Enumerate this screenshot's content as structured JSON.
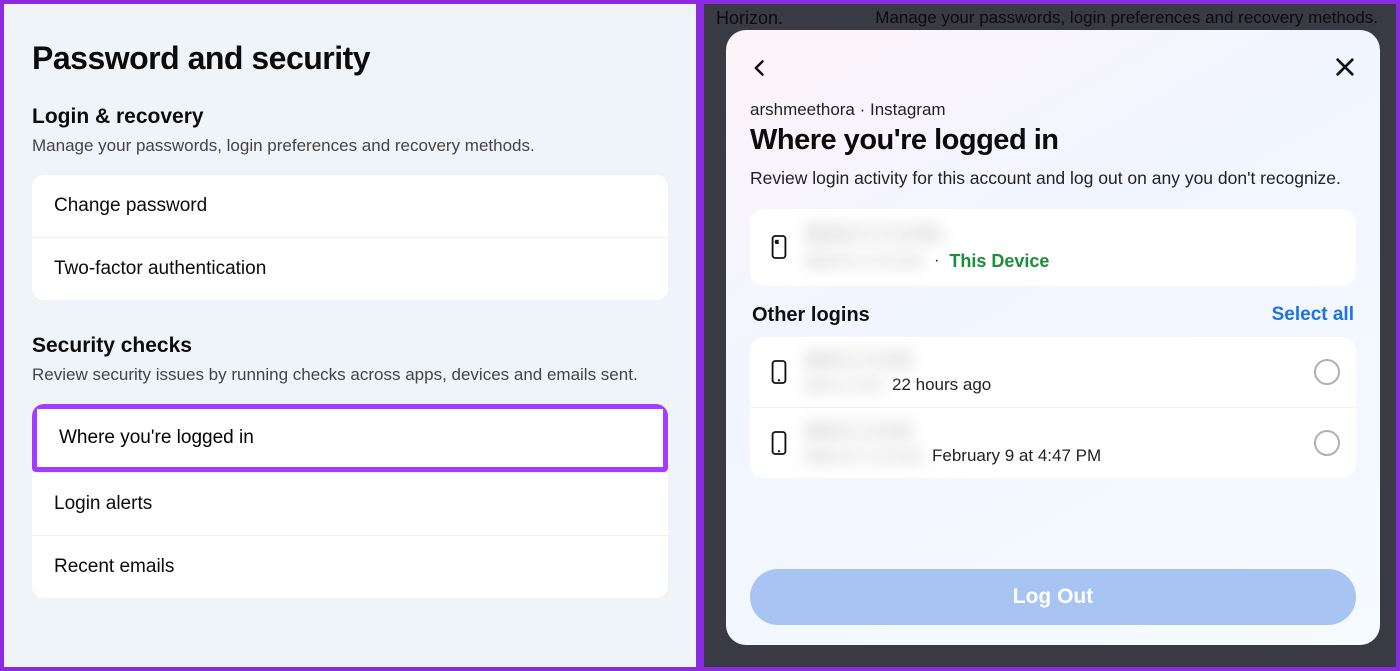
{
  "left": {
    "title": "Password and security",
    "login_recovery": {
      "heading": "Login & recovery",
      "desc": "Manage your passwords, login preferences and recovery methods.",
      "items": [
        "Change password",
        "Two-factor authentication"
      ]
    },
    "security_checks": {
      "heading": "Security checks",
      "desc": "Review security issues by running checks across apps, devices and emails sent.",
      "items": [
        "Where you're logged in",
        "Login alerts",
        "Recent emails"
      ],
      "highlighted_index": 0
    }
  },
  "right": {
    "bg_word": "Horizon.",
    "bg_hint": "Manage your passwords, login preferences and recovery methods.",
    "account_line": "arshmeethora · Instagram",
    "heading": "Where you're logged in",
    "desc": "Review login activity for this account and log out on any you don't recognize.",
    "this_device_label": "This Device",
    "other_logins_heading": "Other logins",
    "select_all": "Select all",
    "logins": [
      {
        "time": "22 hours ago"
      },
      {
        "time": "February 9 at 4:47 PM"
      }
    ],
    "logout": "Log Out"
  }
}
